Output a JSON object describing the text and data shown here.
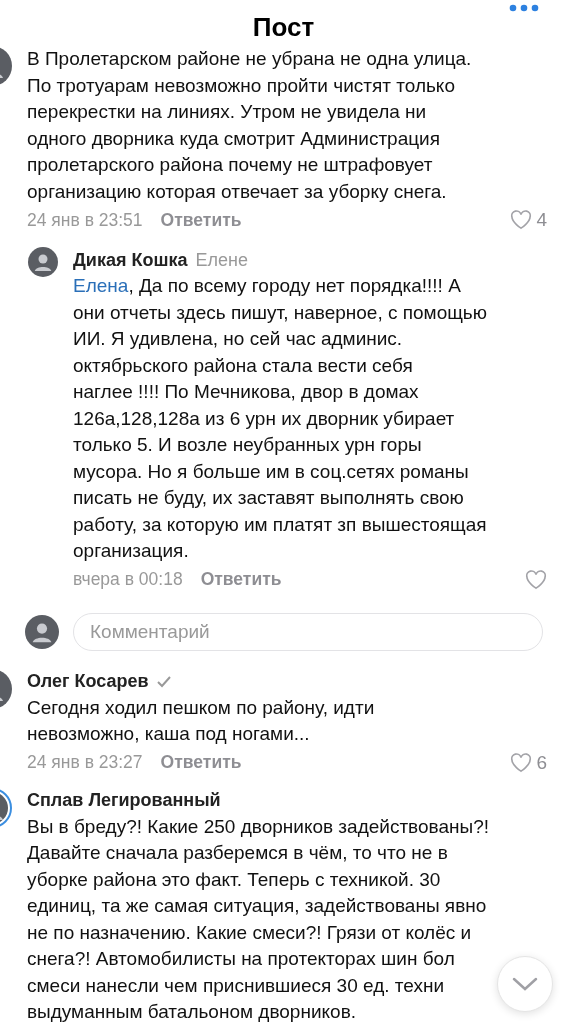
{
  "header": {
    "title": "Пост"
  },
  "comments": [
    {
      "kind": "comment",
      "text": "В Пролетарском районе не убрана не одна улица.\nПо тротуарам невозможно пройти чистят только\nперекрестки на линиях. Утром не увидела ни\nодного дворника куда смотрит Администрация\nпролетарского района почему не штрафовует\nорганизацию которая отвечает за уборку снега.",
      "time": "24 янв в 23:51",
      "reply": "Ответить",
      "likes": "4"
    },
    {
      "kind": "reply",
      "author": "Дикая Кошка",
      "reply_to": "Елене",
      "mention": "Елена",
      "text": ", Да по всему городу нет порядка!!!! А\nони отчеты здесь пишут, наверное, с помощью\nИИ.  Я удивлена, но сей час админис.\nоктябрьского района стала вести себя\nнаглее !!!! По Мечникова, двор в домах\n126а,128,128а  из 6 урн их дворник убирает\nтолько 5. И возле неубранных урн горы\nмусора. Но я больше им в соц.сетях романы\nписать не буду, их заставят выполнять свою\nработу, за которую им платят зп  вышестоящая\nорганизация.",
      "time": "вчера в 00:18",
      "reply": "Ответить"
    },
    {
      "kind": "input",
      "placeholder": "Комментарий"
    },
    {
      "kind": "comment",
      "author": "Олег Косарев",
      "verified": true,
      "text": "Сегодня ходил пешком по району, идти\nневозможно, каша под ногами...",
      "time": "24 янв в 23:27",
      "reply": "Ответить",
      "likes": "6"
    },
    {
      "kind": "comment",
      "author": "Сплав Легированный",
      "story": true,
      "text": "Вы в бреду?! Какие 250 дворников задействованы?!\nДавайте сначала разберемся в чём, то что не в\nуборке района это факт. Теперь с техникой. 30\nединиц, та же самая ситуация, задействованы явно\nне по назначению. Какие смеси?! Грязи от колёс и\nснега?! Автомобилисты на протекторах шин бол\nсмеси нанесли чем приснившиеся 30 ед. техни\nвыдуманным батальоном дворников."
    }
  ]
}
